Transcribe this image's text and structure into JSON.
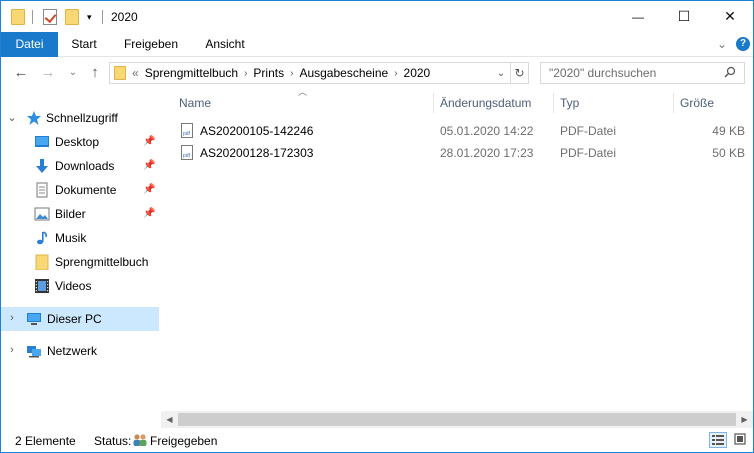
{
  "window": {
    "title": "2020",
    "controls": {
      "minimize": "—",
      "maximize": "☐",
      "close": "✕"
    }
  },
  "ribbon": {
    "tabs": [
      {
        "label": "Datei",
        "active": true
      },
      {
        "label": "Start"
      },
      {
        "label": "Freigeben"
      },
      {
        "label": "Ansicht"
      }
    ],
    "expand_glyph": "⌄",
    "help_glyph": "?"
  },
  "nav": {
    "back": "←",
    "forward": "→",
    "recent": "⌄",
    "up": "↑",
    "address": {
      "overflow": "«",
      "segments": [
        "Sprengmittelbuch",
        "Prints",
        "Ausgabescheine",
        "2020"
      ],
      "separator": "›",
      "dropdown": "⌄",
      "refresh": "↻"
    },
    "search": {
      "placeholder": "\"2020\" durchsuchen"
    }
  },
  "navpane": {
    "quick_access": "Schnellzugriff",
    "items": [
      {
        "label": "Desktop",
        "icon": "desktop-icon",
        "pinned": true
      },
      {
        "label": "Downloads",
        "icon": "download-icon",
        "pinned": true
      },
      {
        "label": "Dokumente",
        "icon": "documents-icon",
        "pinned": true
      },
      {
        "label": "Bilder",
        "icon": "pictures-icon",
        "pinned": true
      },
      {
        "label": "Musik",
        "icon": "music-icon",
        "pinned": false
      },
      {
        "label": "Sprengmittelbuch",
        "icon": "folder-icon",
        "pinned": false
      },
      {
        "label": "Videos",
        "icon": "videos-icon",
        "pinned": false
      }
    ],
    "this_pc": "Dieser PC",
    "network": "Netzwerk",
    "expand_open": "⌄",
    "expand_closed": "›"
  },
  "columns": [
    "Name",
    "Änderungsdatum",
    "Typ",
    "Größe"
  ],
  "files": [
    {
      "name": "AS20200105-142246",
      "date": "05.01.2020 14:22",
      "type": "PDF-Datei",
      "size": "49 KB"
    },
    {
      "name": "AS20200128-172303",
      "date": "28.01.2020 17:23",
      "type": "PDF-Datei",
      "size": "50 KB"
    }
  ],
  "status": {
    "count": "2 Elemente",
    "status_label": "Status:",
    "status_value": "Freigegeben"
  },
  "scroll": {
    "left": "◀",
    "right": "▶"
  },
  "colors": {
    "accent": "#1979ca",
    "selection": "#cce8ff",
    "header_text": "#4c607a"
  }
}
